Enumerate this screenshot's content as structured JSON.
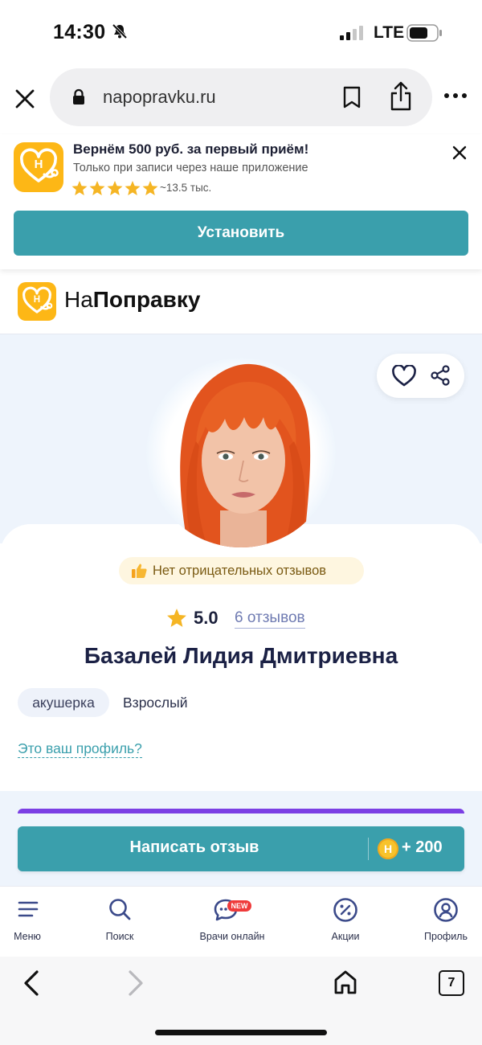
{
  "status_bar": {
    "time": "14:30",
    "network": "LTE"
  },
  "browser": {
    "url": "napopravku.ru",
    "tab_count": "7"
  },
  "app_banner": {
    "title": "Вернём 500 руб. за первый приём!",
    "subtitle": "Только при записи через наше приложение",
    "rating_stars": 5,
    "rating_count": "~13.5 тыс.",
    "install_label": "Установить",
    "logo_letter": "Н"
  },
  "site": {
    "name_prefix": "На",
    "name_bold": "Поправку"
  },
  "profile": {
    "no_negative_badge": "Нет отрицательных отзывов",
    "rating": "5.0",
    "reviews_link": "6 отзывов",
    "name": "Базалей Лидия Дмитриевна",
    "specialty": "акушерка",
    "age_group": "Взрослый",
    "claim_link": "Это ваш профиль?"
  },
  "review_button": {
    "label": "Написать отзыв",
    "coin_letter": "Н",
    "bonus": "+ 200"
  },
  "bottom_nav": {
    "items": [
      {
        "label": "Меню",
        "icon": "menu-icon"
      },
      {
        "label": "Поиск",
        "icon": "search-icon"
      },
      {
        "label": "Врачи онлайн",
        "icon": "chat-icon"
      },
      {
        "label": "Акции",
        "icon": "percent-icon"
      },
      {
        "label": "Профиль",
        "icon": "user-icon"
      }
    ],
    "new_badge": "NEW"
  },
  "colors": {
    "accent": "#3a9fac",
    "brand_yellow": "#fdb716",
    "star": "#f5b524"
  }
}
